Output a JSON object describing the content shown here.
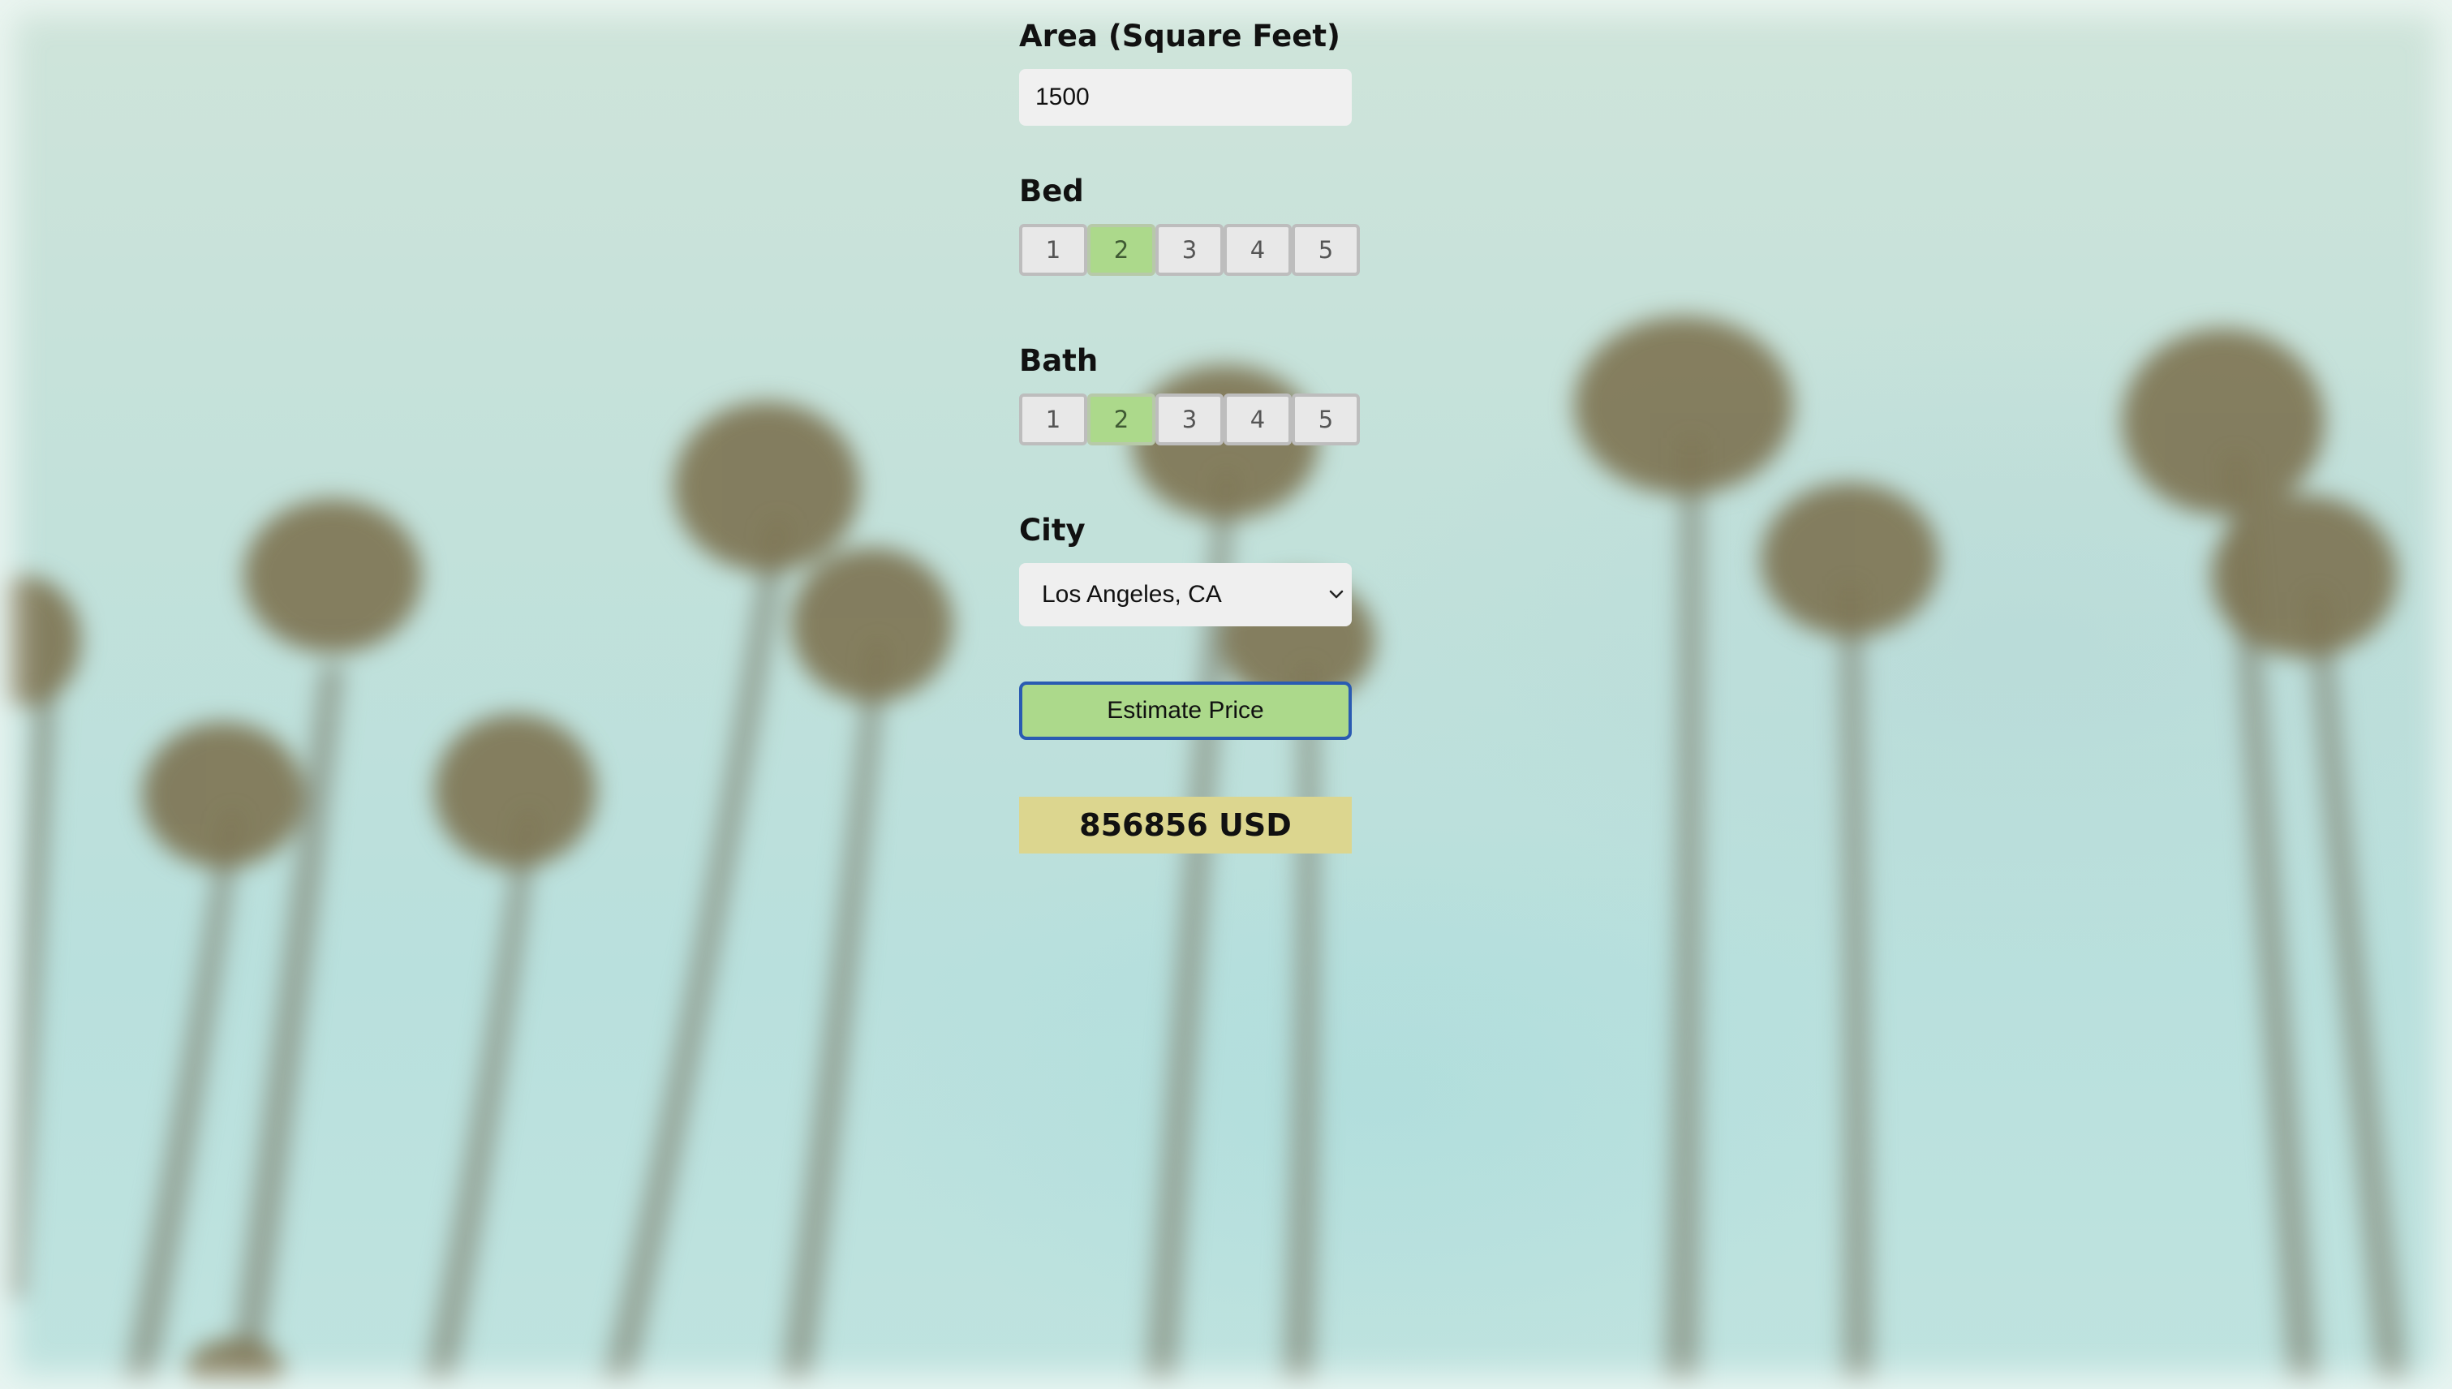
{
  "form": {
    "area": {
      "label": "Area (Square Feet)",
      "value": "1500"
    },
    "bed": {
      "label": "Bed",
      "options": [
        "1",
        "2",
        "3",
        "4",
        "5"
      ],
      "selected": "2"
    },
    "bath": {
      "label": "Bath",
      "options": [
        "1",
        "2",
        "3",
        "4",
        "5"
      ],
      "selected": "2"
    },
    "city": {
      "label": "City",
      "selected": "Los Angeles, CA"
    },
    "estimate_label": "Estimate Price",
    "result": "856856 USD"
  },
  "colors": {
    "selected_option": "#acd98b",
    "button_border": "#2a5bb2",
    "result_background": "#dcd68f"
  }
}
